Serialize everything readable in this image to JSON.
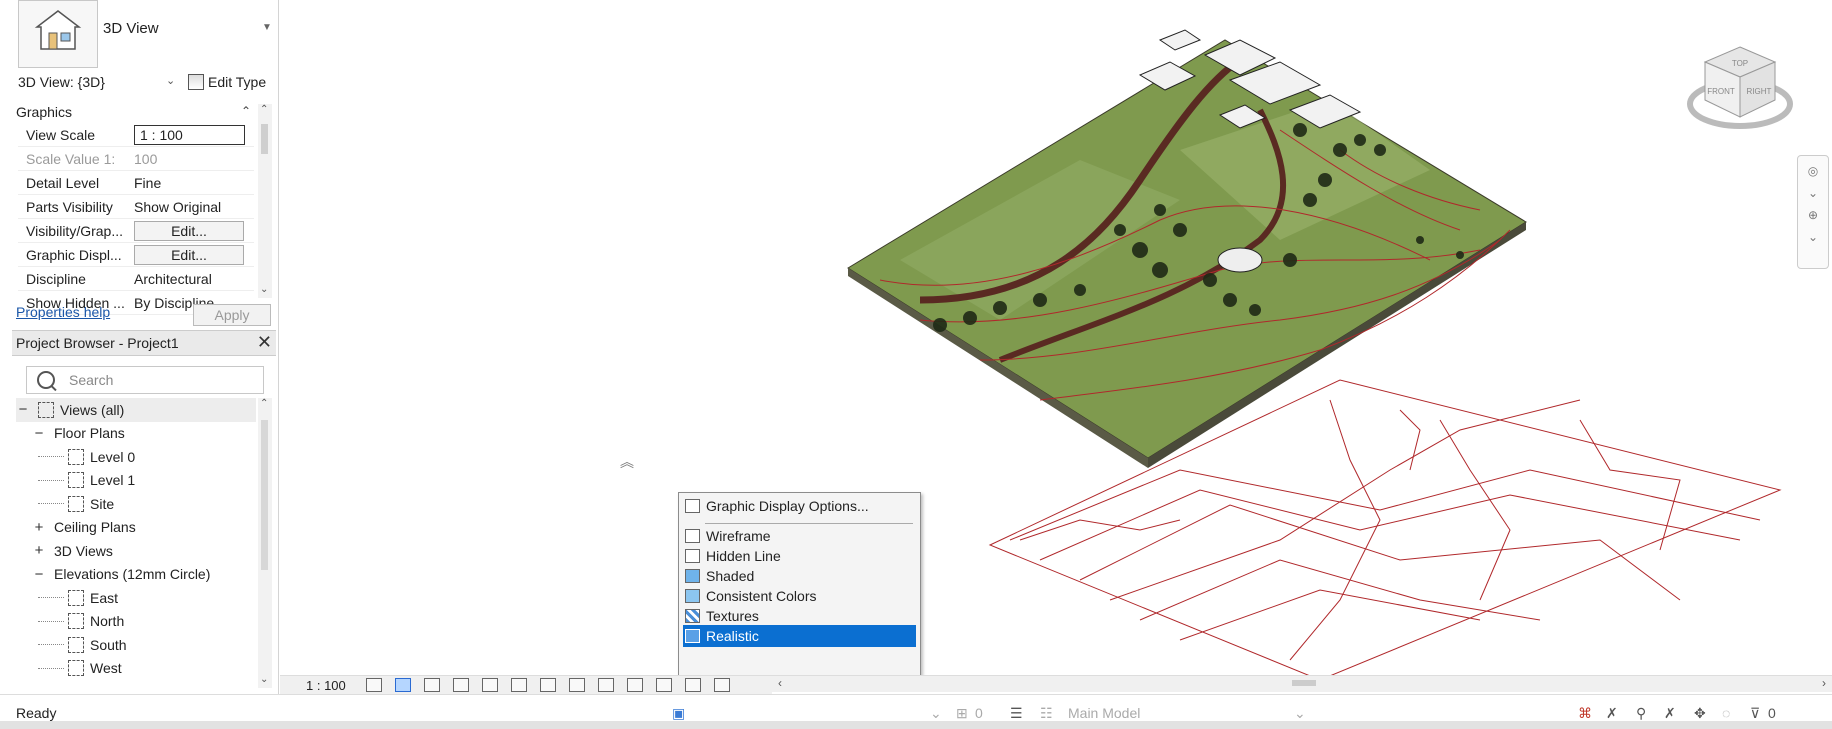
{
  "properties": {
    "type_name": "3D View",
    "view_selector": "3D View: {3D}",
    "edit_type_label": "Edit Type",
    "group_label": "Graphics",
    "rows": [
      {
        "key": "View Scale",
        "value": "1 : 100",
        "kind": "input"
      },
      {
        "key": "Scale Value    1:",
        "value": "100",
        "kind": "dim"
      },
      {
        "key": "Detail Level",
        "value": "Fine",
        "kind": "text"
      },
      {
        "key": "Parts Visibility",
        "value": "Show Original",
        "kind": "text"
      },
      {
        "key": "Visibility/Grap...",
        "value": "Edit...",
        "kind": "button"
      },
      {
        "key": "Graphic Displ...",
        "value": "Edit...",
        "kind": "button"
      },
      {
        "key": "Discipline",
        "value": "Architectural",
        "kind": "text"
      },
      {
        "key": "Show Hidden ...",
        "value": "By Discipline",
        "kind": "text"
      }
    ],
    "help_link": "Properties help",
    "apply_label": "Apply"
  },
  "browser": {
    "title": "Project Browser - Project1",
    "search_placeholder": "Search",
    "tree": [
      {
        "label": "Views (all)",
        "toggle": "−",
        "level": 0
      },
      {
        "label": "Floor Plans",
        "toggle": "−",
        "level": 1
      },
      {
        "label": "Level 0",
        "toggle": "",
        "level": 2
      },
      {
        "label": "Level 1",
        "toggle": "",
        "level": 2
      },
      {
        "label": "Site",
        "toggle": "",
        "level": 2
      },
      {
        "label": "Ceiling Plans",
        "toggle": "+",
        "level": 1
      },
      {
        "label": "3D Views",
        "toggle": "+",
        "level": 1
      },
      {
        "label": "Elevations (12mm Circle)",
        "toggle": "−",
        "level": 1
      },
      {
        "label": "East",
        "toggle": "",
        "level": 2
      },
      {
        "label": "North",
        "toggle": "",
        "level": 2
      },
      {
        "label": "South",
        "toggle": "",
        "level": 2
      },
      {
        "label": "West",
        "toggle": "",
        "level": 2
      }
    ]
  },
  "visual_style_menu": {
    "items": [
      {
        "label": "Graphic Display Options...",
        "selected": false
      },
      {
        "label": "Wireframe",
        "selected": false
      },
      {
        "label": "Hidden Line",
        "selected": false
      },
      {
        "label": "Shaded",
        "selected": false
      },
      {
        "label": "Consistent Colors",
        "selected": false
      },
      {
        "label": "Textures",
        "selected": false
      },
      {
        "label": "Realistic",
        "selected": true
      }
    ]
  },
  "view_control": {
    "scale": "1 : 100"
  },
  "navcube": {
    "top": "TOP",
    "front": "FRONT",
    "right": "RIGHT"
  },
  "status": {
    "text": "Ready",
    "workset": "0",
    "model": "Main Model",
    "filter_count": "0"
  },
  "colors": {
    "selection": "#0b6fd1",
    "terrain": "#7f9a4e",
    "contour": "#b0282b"
  }
}
